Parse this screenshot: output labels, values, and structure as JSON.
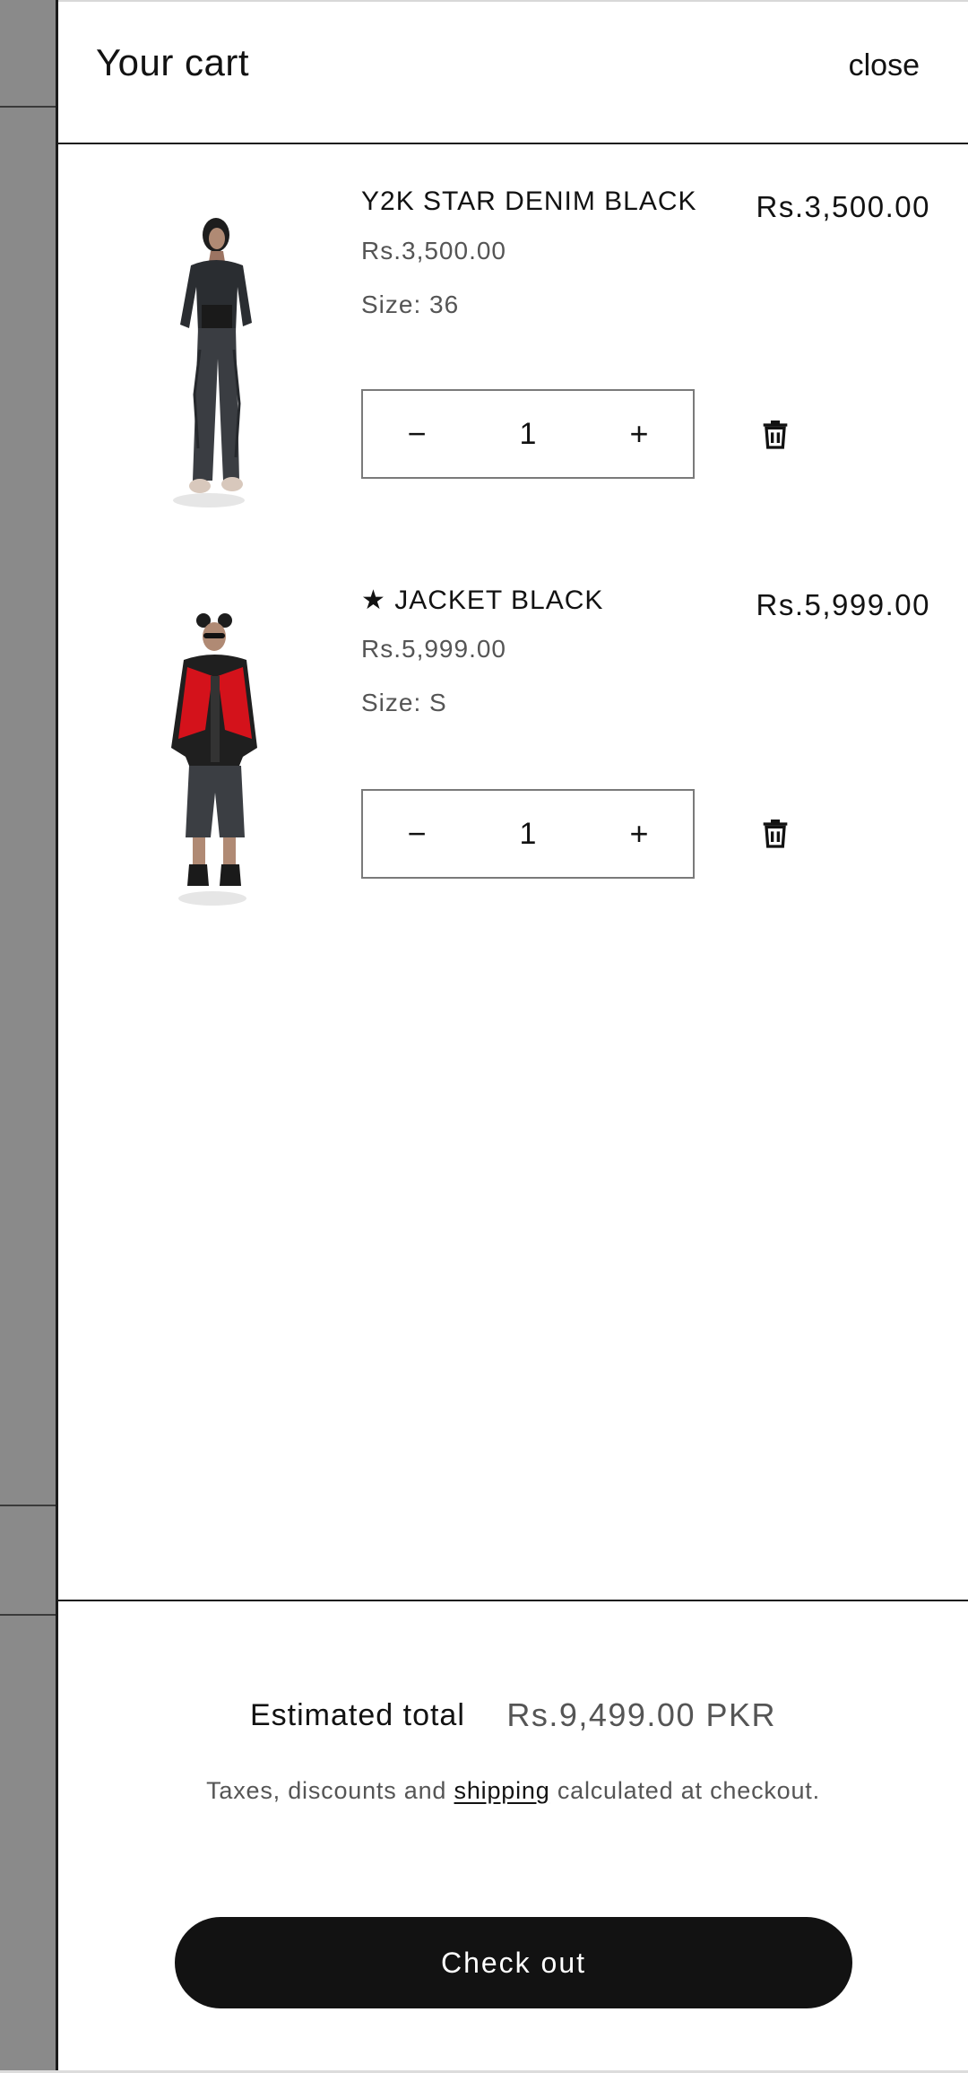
{
  "cart": {
    "title": "Your cart",
    "close_label": "close"
  },
  "items": [
    {
      "name": "Y2K STAR DENIM BLACK",
      "unit_price": "Rs.3,500.00",
      "size": "Size: 36",
      "line_total": "Rs.3,500.00",
      "quantity": "1",
      "minus_label": "−",
      "plus_label": "+",
      "image_icon": "product-photo-denim-icon"
    },
    {
      "name": "★ JACKET BLACK",
      "unit_price": "Rs.5,999.00",
      "size": "Size: S",
      "line_total": "Rs.5,999.00",
      "quantity": "1",
      "minus_label": "−",
      "plus_label": "+",
      "image_icon": "product-photo-jacket-icon"
    }
  ],
  "summary": {
    "estimated_label": "Estimated total",
    "estimated_value": "Rs.9,499.00 PKR",
    "tax_prefix": "Taxes, discounts and ",
    "tax_link": "shipping",
    "tax_suffix": " calculated at checkout.",
    "checkout_label": "Check out"
  },
  "colors": {
    "accent": "#121212",
    "overlay": "#8a8a8a",
    "muted_text": "#555555",
    "jacket_red": "#d4121b"
  }
}
